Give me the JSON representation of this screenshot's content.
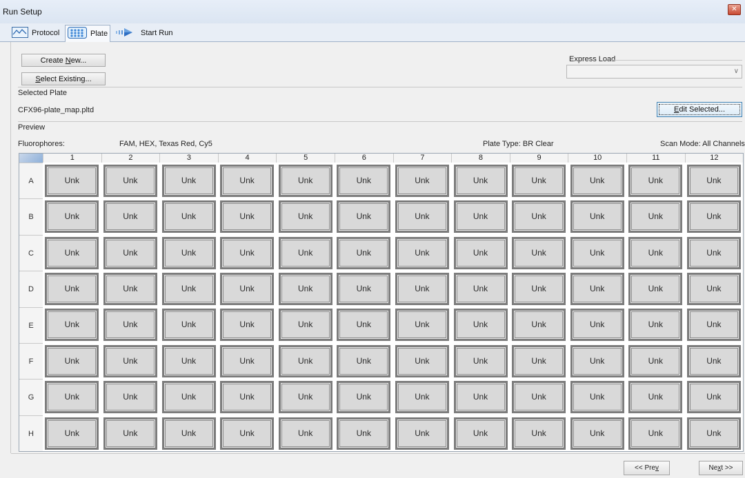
{
  "window": {
    "title": "Run Setup",
    "close_glyph": "✕"
  },
  "tabs": [
    {
      "label": "Protocol",
      "icon": "protocol-icon",
      "active": false
    },
    {
      "label": "Plate",
      "icon": "plate-icon",
      "active": true
    },
    {
      "label": "Start Run",
      "icon": "start-run-icon",
      "active": false
    }
  ],
  "buttons": {
    "create_new": {
      "pre": "Create ",
      "key": "N",
      "post": "ew..."
    },
    "select_existing": {
      "pre": "",
      "key": "S",
      "post": "elect Existing..."
    },
    "edit_selected": {
      "pre": "",
      "key": "E",
      "post": "dit Selected..."
    }
  },
  "express_load": {
    "label": "Express Load",
    "value": ""
  },
  "selected_plate": {
    "label": "Selected Plate",
    "file": "CFX96-plate_map.pltd"
  },
  "preview": {
    "label": "Preview",
    "fluorophores_label": "Fluorophores:",
    "fluorophores_value": "FAM, HEX, Texas Red, Cy5",
    "plate_type": "Plate Type: BR Clear",
    "scan_mode": "Scan Mode: All Channels"
  },
  "plate": {
    "columns": [
      "1",
      "2",
      "3",
      "4",
      "5",
      "6",
      "7",
      "8",
      "9",
      "10",
      "11",
      "12"
    ],
    "rows": [
      "A",
      "B",
      "C",
      "D",
      "E",
      "F",
      "G",
      "H"
    ],
    "well_label": "Unk",
    "well_color": "#d9d9d9"
  },
  "navigation": {
    "prev": {
      "pre": "<< Pre",
      "key": "v",
      "post": ""
    },
    "next": {
      "pre": "Ne",
      "key": "x",
      "post": "t >>"
    }
  }
}
